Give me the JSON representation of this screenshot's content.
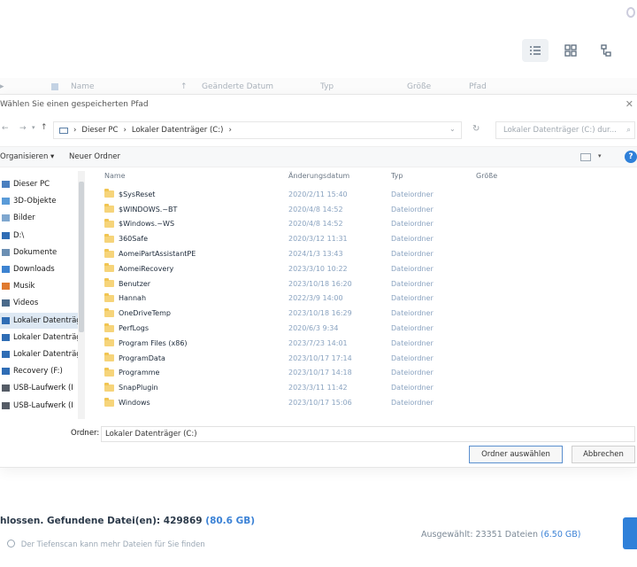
{
  "topbar": {
    "view_buttons": [
      {
        "icon": "list-view-icon",
        "active": true
      },
      {
        "icon": "grid-view-icon",
        "active": false
      },
      {
        "icon": "tree-view-icon",
        "active": false
      }
    ]
  },
  "result_header": {
    "columns": [
      "Name",
      "Geänderte Datum",
      "Typ",
      "Größe",
      "Pfad"
    ]
  },
  "dialog": {
    "title": "Wählen Sie einen gespeicherten Pfad",
    "breadcrumb": [
      "Dieser PC",
      "Lokaler Datenträger (C:)"
    ],
    "search_placeholder": "Lokaler Datenträger (C:) dur...",
    "organize_label": "Organisieren ▾",
    "new_folder_label": "Neuer Ordner",
    "nav_items": [
      {
        "label": "Dieser PC",
        "icon": "pc-icon",
        "selected": false
      },
      {
        "label": "3D-Objekte",
        "icon": "cube-icon",
        "selected": false
      },
      {
        "label": "Bilder",
        "icon": "pictures-icon",
        "selected": false
      },
      {
        "label": "D:\\",
        "icon": "drive-icon",
        "selected": false
      },
      {
        "label": "Dokumente",
        "icon": "documents-icon",
        "selected": false
      },
      {
        "label": "Downloads",
        "icon": "download-icon",
        "selected": false
      },
      {
        "label": "Musik",
        "icon": "music-icon",
        "selected": false
      },
      {
        "label": "Videos",
        "icon": "video-icon",
        "selected": false
      },
      {
        "label": "Lokaler Datenträger (C:)",
        "icon": "drive-icon",
        "selected": true
      },
      {
        "label": "Lokaler Datenträger",
        "icon": "drive-icon",
        "selected": false
      },
      {
        "label": "Lokaler Datenträger",
        "icon": "drive-icon",
        "selected": false
      },
      {
        "label": "Recovery (F:)",
        "icon": "drive-icon",
        "selected": false
      },
      {
        "label": "USB-Laufwerk (I",
        "icon": "usb-icon",
        "selected": false
      },
      {
        "label": "USB-Laufwerk (I",
        "icon": "usb-icon",
        "selected": false
      }
    ],
    "columns": {
      "name": "Name",
      "date": "Änderungsdatum",
      "type": "Typ",
      "size": "Größe"
    },
    "files": [
      {
        "name": "$SysReset",
        "date": "2020/2/11 15:40",
        "type": "Dateiordner"
      },
      {
        "name": "$WINDOWS.~BT",
        "date": "2020/4/8 14:52",
        "type": "Dateiordner"
      },
      {
        "name": "$Windows.~WS",
        "date": "2020/4/8 14:52",
        "type": "Dateiordner"
      },
      {
        "name": "360Safe",
        "date": "2020/3/12 11:31",
        "type": "Dateiordner"
      },
      {
        "name": "AomeiPartAssistantPE",
        "date": "2024/1/3 13:43",
        "type": "Dateiordner"
      },
      {
        "name": "AomeiRecovery",
        "date": "2023/3/10 10:22",
        "type": "Dateiordner"
      },
      {
        "name": "Benutzer",
        "date": "2023/10/18 16:20",
        "type": "Dateiordner"
      },
      {
        "name": "Hannah",
        "date": "2022/3/9 14:00",
        "type": "Dateiordner"
      },
      {
        "name": "OneDriveTemp",
        "date": "2023/10/18 16:29",
        "type": "Dateiordner"
      },
      {
        "name": "PerfLogs",
        "date": "2020/6/3 9:34",
        "type": "Dateiordner"
      },
      {
        "name": "Program Files (x86)",
        "date": "2023/7/23 14:01",
        "type": "Dateiordner"
      },
      {
        "name": "ProgramData",
        "date": "2023/10/17 17:14",
        "type": "Dateiordner"
      },
      {
        "name": "Programme",
        "date": "2023/10/17 14:18",
        "type": "Dateiordner"
      },
      {
        "name": "SnapPlugin",
        "date": "2023/3/11 11:42",
        "type": "Dateiordner"
      },
      {
        "name": "Windows",
        "date": "2023/10/17 15:06",
        "type": "Dateiordner"
      }
    ],
    "folder_label": "Ordner:",
    "folder_value": "Lokaler Datenträger (C:)",
    "select_button": "Ordner auswählen",
    "cancel_button": "Abbrechen"
  },
  "status": {
    "found_text": "hlossen. Gefundene Datei(en): 429869",
    "found_size": "(80.6 GB)",
    "hint": "Der Tiefenscan kann mehr Dateien für Sie finden",
    "selected_text": "Ausgewählt: 23351 Dateien",
    "selected_size": "(6.50 GB)"
  }
}
